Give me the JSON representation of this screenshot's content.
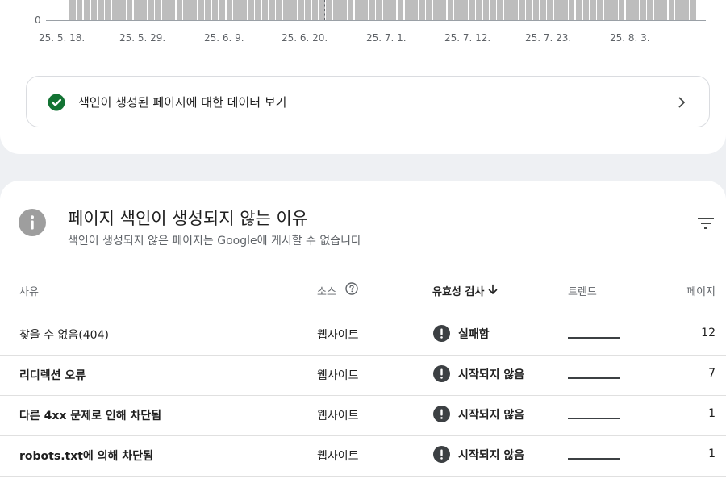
{
  "chart": {
    "zero_label": "0",
    "x_ticks": [
      "25. 5. 18.",
      "25. 5. 29.",
      "25. 6. 9.",
      "25. 6. 20.",
      "25. 7. 1.",
      "25. 7. 12.",
      "25. 7. 23.",
      "25. 8. 3."
    ],
    "bar_color": "#bdbdbd"
  },
  "chart_data": {
    "type": "bar",
    "x_ticks": [
      "25. 5. 18.",
      "25. 5. 29.",
      "25. 6. 9.",
      "25. 6. 20.",
      "25. 7. 1.",
      "25. 7. 12.",
      "25. 7. 23.",
      "25. 8. 3."
    ],
    "y_visible_tick": "0",
    "note_visible": "Only the bottom portion of bars is visible above the baseline at 0"
  },
  "indexed_link": {
    "label": "색인이 생성된 페이지에 대한 데이터 보기",
    "icon": "check-circle-icon",
    "icon_color": "#137333"
  },
  "reasons": {
    "title": "페이지 색인이 생성되지 않는 이유",
    "subtitle": "색인이 생성되지 않은 페이지는 Google에 게시할 수 없습니다",
    "icon": "info-icon",
    "columns": {
      "reason": "사유",
      "source": "소스",
      "validation": "유효성 검사",
      "trend": "트렌드",
      "pages": "페이지"
    },
    "rows": [
      {
        "reason": "찾을 수 없음(404)",
        "source": "웹사이트",
        "status": "실패함",
        "pages": "12"
      },
      {
        "reason": "리디렉션 오류",
        "source": "웹사이트",
        "status": "시작되지 않음",
        "pages": "7"
      },
      {
        "reason": "다른 4xx 문제로 인해 차단됨",
        "source": "웹사이트",
        "status": "시작되지 않음",
        "pages": "1"
      },
      {
        "reason": "robots.txt에 의해 차단됨",
        "source": "웹사이트",
        "status": "시작되지 않음",
        "pages": "1"
      }
    ],
    "status_icon_color": "#3c4043"
  }
}
